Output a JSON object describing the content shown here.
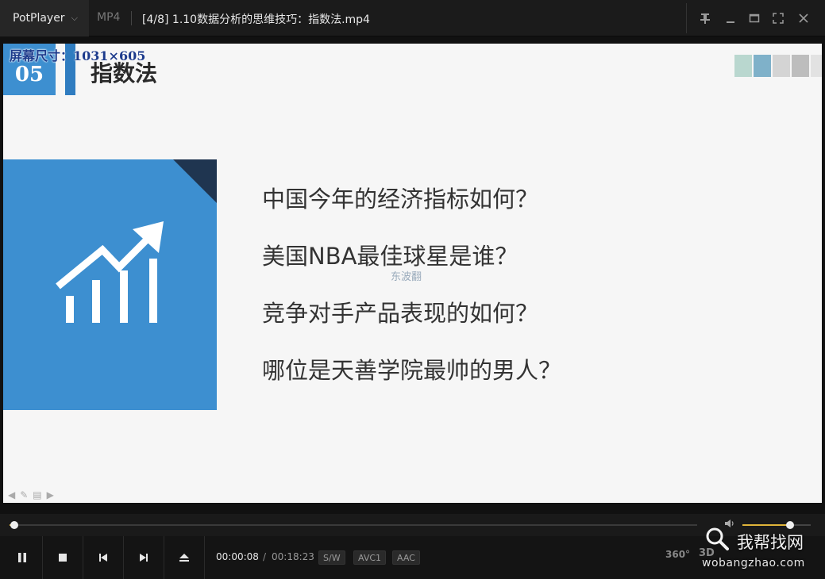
{
  "titlebar": {
    "app_name": "PotPlayer",
    "format": "MP4",
    "file_title": "[4/8] 1.10数据分析的思维技巧：指数法.mp4"
  },
  "video": {
    "screen_size_label": "屏幕尺寸：1031×605",
    "section_number": "05",
    "section_title": "指数法",
    "questions": [
      "中国今年的经济指标如何？",
      "美国NBA最佳球星是谁？",
      "竞争对手产品表现的如何？",
      "哪位是天善学院最帅的男人？"
    ],
    "watermark": "东波翻"
  },
  "seekbar": {
    "progress": 0.0074,
    "volume": 0.7
  },
  "controls": {
    "current_time": "00:00:08",
    "separator": "/",
    "duration": "00:18:23",
    "badges": [
      "S/W",
      "AVC1",
      "AAC"
    ],
    "right_items": [
      "360°",
      "3D"
    ]
  },
  "site": {
    "name": "我帮找网",
    "url": "wobangzhao.com"
  },
  "colors": {
    "accent_blue": "#3d8fd0",
    "seek_fill": "#d9b34a",
    "volume_fill": "#e0b43a"
  }
}
